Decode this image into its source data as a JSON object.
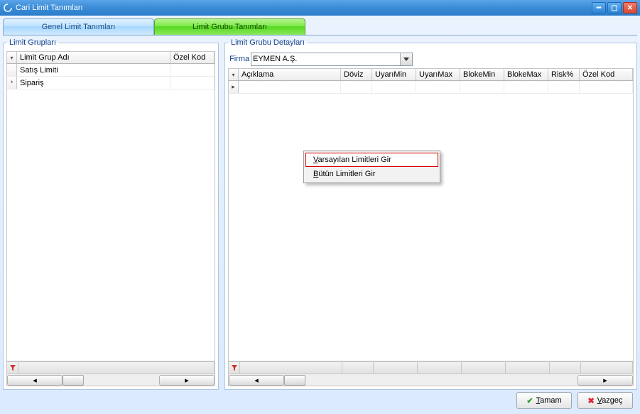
{
  "window": {
    "title": "Cari Limit Tanımları"
  },
  "tabs": {
    "general": "Genel Limit Tanımları",
    "group": "Limit Grubu Tanımları"
  },
  "left_panel": {
    "title": "Limit Grupları",
    "columns": {
      "name": "Limit Grup Adı",
      "code": "Özel Kod"
    },
    "rows": [
      {
        "name": "Satış Limiti",
        "code": "",
        "indicator": ""
      },
      {
        "name": "Sipariş",
        "code": "",
        "indicator": "*"
      }
    ]
  },
  "right_panel": {
    "title": "Limit Grubu Detayları",
    "firm_label": "Firma",
    "firm_value": "EYMEN A.Ş.",
    "columns": {
      "aciklama": "Açıklama",
      "doviz": "Döviz",
      "uyarimin": "UyarıMin",
      "uyarimax": "UyarıMax",
      "blokemin": "BlokeMin",
      "blokemax": "BlokeMax",
      "risk": "Risk%",
      "ozelkod": "Özel Kod"
    }
  },
  "context_menu": {
    "item1": "arsayılan Limitleri Gir",
    "item1_ul": "V",
    "item2": "ütün Limitleri Gir",
    "item2_ul": "B"
  },
  "footer": {
    "ok": "amam",
    "ok_ul": "T",
    "cancel": "azgeç",
    "cancel_ul": "V"
  }
}
